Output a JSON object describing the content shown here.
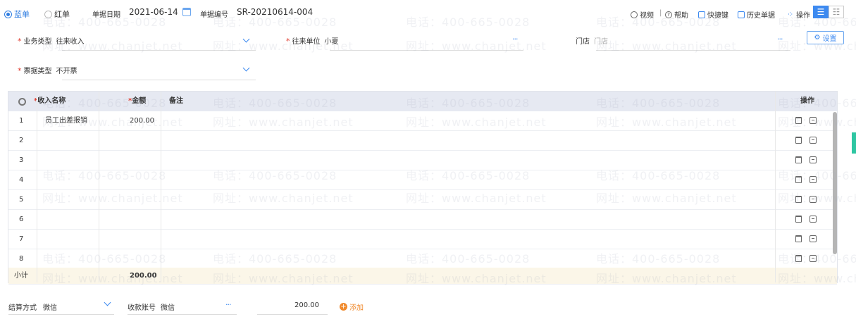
{
  "header": {
    "radio_blue": "蓝单",
    "radio_red": "红单",
    "date_label": "单据日期",
    "date_value": "2021-06-14",
    "no_label": "单据编号",
    "no_value": "SR-20210614-004",
    "tools": {
      "video": "视频",
      "sep": "|",
      "help": "帮助",
      "shortcut": "快捷键",
      "history": "历史单据",
      "ops": "操作"
    }
  },
  "form": {
    "business_type": {
      "label": "业务类型",
      "value": "往来收入"
    },
    "partner": {
      "label": "往来单位",
      "value": "小夏"
    },
    "store": {
      "label": "门店",
      "placeholder": "门店"
    },
    "invoice_type": {
      "label": "票据类型",
      "value": "不开票"
    },
    "settings": "设置"
  },
  "table": {
    "headers": {
      "name": "收入名称",
      "amount": "金额",
      "remark": "备注",
      "ops": "操作"
    },
    "rows": [
      {
        "no": "1",
        "name": "员工出差报销",
        "amount": "200.00",
        "remark": ""
      },
      {
        "no": "2",
        "name": "",
        "amount": "",
        "remark": ""
      },
      {
        "no": "3",
        "name": "",
        "amount": "",
        "remark": ""
      },
      {
        "no": "4",
        "name": "",
        "amount": "",
        "remark": ""
      },
      {
        "no": "5",
        "name": "",
        "amount": "",
        "remark": ""
      },
      {
        "no": "6",
        "name": "",
        "amount": "",
        "remark": ""
      },
      {
        "no": "7",
        "name": "",
        "amount": "",
        "remark": ""
      },
      {
        "no": "8",
        "name": "",
        "amount": "",
        "remark": ""
      }
    ],
    "subtotal_label": "小计",
    "subtotal_amount": "200.00"
  },
  "footer": {
    "settle_label": "结算方式",
    "settle_value": "微信",
    "account_label": "收款账号",
    "account_value": "微信",
    "amount": "200.00",
    "add": "添加"
  },
  "watermark": {
    "phone": "电话：400-665-0028",
    "site": "网址：www.chanjet.net"
  },
  "colors": {
    "accent": "#3d8af0",
    "required": "#e03c2f",
    "subtotal_bg": "#fbf6e8",
    "header_bg": "#e6e9f2"
  }
}
